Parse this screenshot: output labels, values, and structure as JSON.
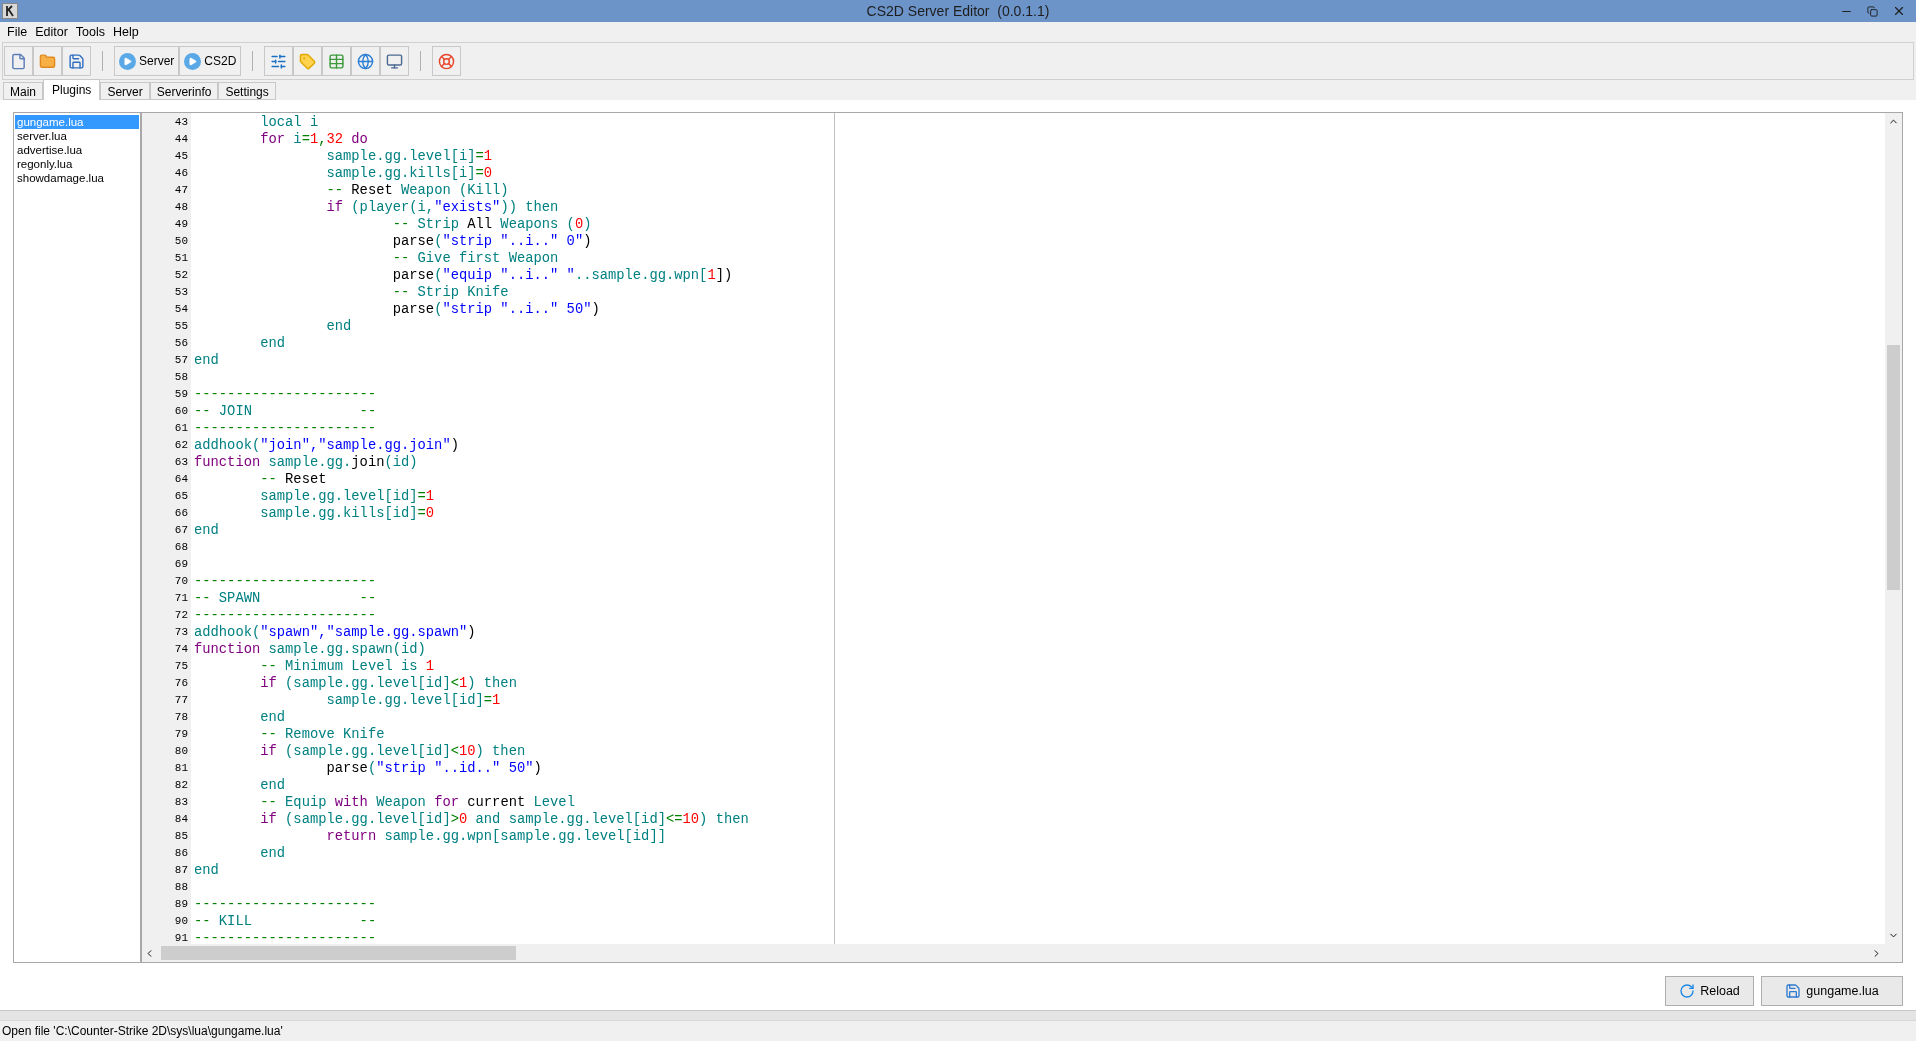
{
  "window": {
    "title": "CS2D Server Editor  (0.0.1.1)"
  },
  "menu": [
    "File",
    "Editor",
    "Tools",
    "Help"
  ],
  "toolbar": {
    "run_buttons": [
      {
        "label": "Server"
      },
      {
        "label": "CS2D"
      }
    ]
  },
  "tabs": [
    {
      "label": "Main",
      "selected": false
    },
    {
      "label": "Plugins",
      "selected": true
    },
    {
      "label": "Server",
      "selected": false
    },
    {
      "label": "Serverinfo",
      "selected": false
    },
    {
      "label": "Settings",
      "selected": false
    }
  ],
  "files": [
    {
      "name": "gungame.lua",
      "selected": true
    },
    {
      "name": "server.lua",
      "selected": false
    },
    {
      "name": "advertise.lua",
      "selected": false
    },
    {
      "name": "regonly.lua",
      "selected": false
    },
    {
      "name": "showdamage.lua",
      "selected": false
    }
  ],
  "code_lines": [
    {
      "number": "43",
      "tokens": [
        {
          "kind": "ident",
          "text": "\tlocal i"
        }
      ]
    },
    {
      "number": "44",
      "tokens": [
        {
          "kind": "keyword",
          "text": "\tfor"
        },
        {
          "kind": "ident",
          "text": " i"
        },
        {
          "kind": "op",
          "text": "="
        },
        {
          "kind": "number",
          "text": "1"
        },
        {
          "kind": "op",
          "text": ","
        },
        {
          "kind": "number",
          "text": "32"
        },
        {
          "kind": "keyword",
          "text": " do"
        }
      ]
    },
    {
      "number": "45",
      "tokens": [
        {
          "kind": "ident",
          "text": "\t\tsample.gg.level[i]"
        },
        {
          "kind": "op",
          "text": "="
        },
        {
          "kind": "number",
          "text": "1"
        }
      ]
    },
    {
      "number": "46",
      "tokens": [
        {
          "kind": "ident",
          "text": "\t\tsample.gg.kills[i]"
        },
        {
          "kind": "op",
          "text": "="
        },
        {
          "kind": "number",
          "text": "0"
        }
      ]
    },
    {
      "number": "47",
      "tokens": [
        {
          "kind": "op",
          "text": "\t\t--"
        },
        {
          "kind": "plain",
          "text": " Reset"
        },
        {
          "kind": "ident",
          "text": " Weapon (Kill)"
        }
      ]
    },
    {
      "number": "48",
      "tokens": [
        {
          "kind": "keyword",
          "text": "\t\tif"
        },
        {
          "kind": "ident",
          "text": " (player(i,"
        },
        {
          "kind": "string",
          "text": "\"exists\""
        },
        {
          "kind": "ident",
          "text": ")) then"
        }
      ]
    },
    {
      "number": "49",
      "tokens": [
        {
          "kind": "op",
          "text": "\t\t\t--"
        },
        {
          "kind": "ident",
          "text": " Strip"
        },
        {
          "kind": "plain",
          "text": " All"
        },
        {
          "kind": "ident",
          "text": " Weapons ("
        },
        {
          "kind": "number",
          "text": "0"
        },
        {
          "kind": "ident",
          "text": ")"
        }
      ]
    },
    {
      "number": "50",
      "tokens": [
        {
          "kind": "plain",
          "text": "\t\t\tparse"
        },
        {
          "kind": "ident",
          "text": "("
        },
        {
          "kind": "string",
          "text": "\"strip \"..i..\" 0\""
        },
        {
          "kind": "plain",
          "text": ")"
        }
      ]
    },
    {
      "number": "51",
      "tokens": [
        {
          "kind": "op",
          "text": "\t\t\t--"
        },
        {
          "kind": "ident",
          "text": " Give first Weapon"
        }
      ]
    },
    {
      "number": "52",
      "tokens": [
        {
          "kind": "plain",
          "text": "\t\t\tparse"
        },
        {
          "kind": "ident",
          "text": "("
        },
        {
          "kind": "string",
          "text": "\"equip \"..i..\" \""
        },
        {
          "kind": "ident",
          "text": "..sample.gg.wpn["
        },
        {
          "kind": "number",
          "text": "1"
        },
        {
          "kind": "plain",
          "text": "])"
        }
      ]
    },
    {
      "number": "53",
      "tokens": [
        {
          "kind": "op",
          "text": "\t\t\t--"
        },
        {
          "kind": "ident",
          "text": " Strip Knife"
        }
      ]
    },
    {
      "number": "54",
      "tokens": [
        {
          "kind": "plain",
          "text": "\t\t\tparse"
        },
        {
          "kind": "ident",
          "text": "("
        },
        {
          "kind": "string",
          "text": "\"strip \"..i..\" 50\""
        },
        {
          "kind": "plain",
          "text": ")"
        }
      ]
    },
    {
      "number": "55",
      "tokens": [
        {
          "kind": "ident",
          "text": "\t\tend"
        }
      ]
    },
    {
      "number": "56",
      "tokens": [
        {
          "kind": "ident",
          "text": "\tend"
        }
      ]
    },
    {
      "number": "57",
      "tokens": [
        {
          "kind": "ident",
          "text": "end"
        }
      ]
    },
    {
      "number": "58"
    },
    {
      "number": "59",
      "tokens": [
        {
          "kind": "op",
          "text": "----------------------"
        }
      ]
    },
    {
      "number": "60",
      "tokens": [
        {
          "kind": "op",
          "text": "--"
        },
        {
          "kind": "ident",
          "text": " JOIN"
        },
        {
          "kind": "op",
          "text": "             --"
        }
      ]
    },
    {
      "number": "61",
      "tokens": [
        {
          "kind": "op",
          "text": "----------------------"
        }
      ]
    },
    {
      "number": "62",
      "tokens": [
        {
          "kind": "ident",
          "text": "addhook("
        },
        {
          "kind": "string",
          "text": "\"join\",\"sample.gg.join\""
        },
        {
          "kind": "plain",
          "text": ")"
        }
      ]
    },
    {
      "number": "63",
      "tokens": [
        {
          "kind": "keyword",
          "text": "function"
        },
        {
          "kind": "ident",
          "text": " sample.gg."
        },
        {
          "kind": "plain",
          "text": "join"
        },
        {
          "kind": "ident",
          "text": "(id)"
        }
      ]
    },
    {
      "number": "64",
      "tokens": [
        {
          "kind": "op",
          "text": "\t--"
        },
        {
          "kind": "plain",
          "text": " Reset"
        }
      ]
    },
    {
      "number": "65",
      "tokens": [
        {
          "kind": "ident",
          "text": "\tsample.gg.level[id]"
        },
        {
          "kind": "op",
          "text": "="
        },
        {
          "kind": "number",
          "text": "1"
        }
      ]
    },
    {
      "number": "66",
      "tokens": [
        {
          "kind": "ident",
          "text": "\tsample.gg.kills[id]"
        },
        {
          "kind": "op",
          "text": "="
        },
        {
          "kind": "number",
          "text": "0"
        }
      ]
    },
    {
      "number": "67",
      "tokens": [
        {
          "kind": "ident",
          "text": "end"
        }
      ]
    },
    {
      "number": "68"
    },
    {
      "number": "69"
    },
    {
      "number": "70",
      "tokens": [
        {
          "kind": "op",
          "text": "----------------------"
        }
      ]
    },
    {
      "number": "71",
      "tokens": [
        {
          "kind": "op",
          "text": "--"
        },
        {
          "kind": "ident",
          "text": " SPAWN"
        },
        {
          "kind": "op",
          "text": "            --"
        }
      ]
    },
    {
      "number": "72",
      "tokens": [
        {
          "kind": "op",
          "text": "----------------------"
        }
      ]
    },
    {
      "number": "73",
      "tokens": [
        {
          "kind": "ident",
          "text": "addhook("
        },
        {
          "kind": "string",
          "text": "\"spawn\",\"sample.gg.spawn\""
        },
        {
          "kind": "plain",
          "text": ")"
        }
      ]
    },
    {
      "number": "74",
      "tokens": [
        {
          "kind": "keyword",
          "text": "function"
        },
        {
          "kind": "ident",
          "text": " sample.gg.spawn(id)"
        }
      ]
    },
    {
      "number": "75",
      "tokens": [
        {
          "kind": "op",
          "text": "\t--"
        },
        {
          "kind": "ident",
          "text": " Minimum Level is "
        },
        {
          "kind": "number",
          "text": "1"
        }
      ]
    },
    {
      "number": "76",
      "tokens": [
        {
          "kind": "keyword",
          "text": "\tif"
        },
        {
          "kind": "ident",
          "text": " (sample.gg.level[id]"
        },
        {
          "kind": "op",
          "text": "<"
        },
        {
          "kind": "number",
          "text": "1"
        },
        {
          "kind": "ident",
          "text": ") then"
        }
      ]
    },
    {
      "number": "77",
      "tokens": [
        {
          "kind": "ident",
          "text": "\t\tsample.gg.level[id]"
        },
        {
          "kind": "op",
          "text": "="
        },
        {
          "kind": "number",
          "text": "1"
        }
      ]
    },
    {
      "number": "78",
      "tokens": [
        {
          "kind": "ident",
          "text": "\tend"
        }
      ]
    },
    {
      "number": "79",
      "tokens": [
        {
          "kind": "op",
          "text": "\t--"
        },
        {
          "kind": "ident",
          "text": " Remove Knife"
        }
      ]
    },
    {
      "number": "80",
      "tokens": [
        {
          "kind": "keyword",
          "text": "\tif"
        },
        {
          "kind": "ident",
          "text": " (sample.gg.level[id]"
        },
        {
          "kind": "op",
          "text": "<"
        },
        {
          "kind": "number",
          "text": "10"
        },
        {
          "kind": "ident",
          "text": ") then"
        }
      ]
    },
    {
      "number": "81",
      "tokens": [
        {
          "kind": "plain",
          "text": "\t\tparse"
        },
        {
          "kind": "ident",
          "text": "("
        },
        {
          "kind": "string",
          "text": "\"strip \"..id..\" 50\""
        },
        {
          "kind": "plain",
          "text": ")"
        }
      ]
    },
    {
      "number": "82",
      "tokens": [
        {
          "kind": "ident",
          "text": "\tend"
        }
      ]
    },
    {
      "number": "83",
      "tokens": [
        {
          "kind": "op",
          "text": "\t--"
        },
        {
          "kind": "ident",
          "text": " Equip"
        },
        {
          "kind": "keyword",
          "text": " with"
        },
        {
          "kind": "ident",
          "text": " Weapon"
        },
        {
          "kind": "keyword",
          "text": " for"
        },
        {
          "kind": "plain",
          "text": " current"
        },
        {
          "kind": "ident",
          "text": " Level"
        }
      ]
    },
    {
      "number": "84",
      "tokens": [
        {
          "kind": "keyword",
          "text": "\tif"
        },
        {
          "kind": "ident",
          "text": " (sample.gg.level[id]"
        },
        {
          "kind": "op",
          "text": ">"
        },
        {
          "kind": "number",
          "text": "0"
        },
        {
          "kind": "ident",
          "text": " and sample.gg.level[id]"
        },
        {
          "kind": "op",
          "text": "<="
        },
        {
          "kind": "number",
          "text": "10"
        },
        {
          "kind": "ident",
          "text": ") then"
        }
      ]
    },
    {
      "number": "85",
      "tokens": [
        {
          "kind": "keyword",
          "text": "\t\treturn"
        },
        {
          "kind": "ident",
          "text": " sample.gg.wpn[sample.gg.level[id]]"
        }
      ]
    },
    {
      "number": "86",
      "tokens": [
        {
          "kind": "ident",
          "text": "\tend"
        }
      ]
    },
    {
      "number": "87",
      "tokens": [
        {
          "kind": "ident",
          "text": "end"
        }
      ]
    },
    {
      "number": "88"
    },
    {
      "number": "89",
      "tokens": [
        {
          "kind": "op",
          "text": "----------------------"
        }
      ]
    },
    {
      "number": "90",
      "tokens": [
        {
          "kind": "op",
          "text": "--"
        },
        {
          "kind": "ident",
          "text": " KILL"
        },
        {
          "kind": "op",
          "text": "             --"
        }
      ]
    },
    {
      "number": "91",
      "tokens": [
        {
          "kind": "op",
          "text": "----------------------"
        }
      ]
    }
  ],
  "buttons": [
    {
      "kind": "reload",
      "label": "Reload"
    },
    {
      "kind": "save",
      "label": "gungame.lua"
    }
  ],
  "status_bar": "Open file 'C:\\Counter-Strike 2D\\sys\\lua\\gungame.lua'"
}
